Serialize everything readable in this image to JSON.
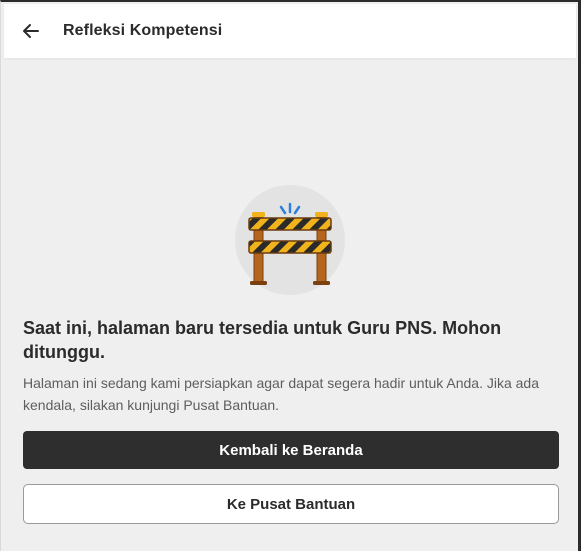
{
  "header": {
    "title": "Refleksi Kompetensi",
    "back_icon": "arrow-left-icon"
  },
  "empty_state": {
    "illustration_icon": "construction-barrier-icon",
    "headline": "Saat ini, halaman baru tersedia untuk Guru PNS. Mohon ditunggu.",
    "description": "Halaman ini sedang kami persiapkan agar dapat segera hadir untuk Anda. Jika ada kendala, silakan kunjungi Pusat Bantuan."
  },
  "actions": {
    "primary_label": "Kembali ke Beranda",
    "secondary_label": "Ke Pusat Bantuan"
  },
  "colors": {
    "background": "#efefef",
    "primary_button": "#2e2e2e",
    "text_dark": "#2b2b2b",
    "text_muted": "#5e5e5e"
  }
}
